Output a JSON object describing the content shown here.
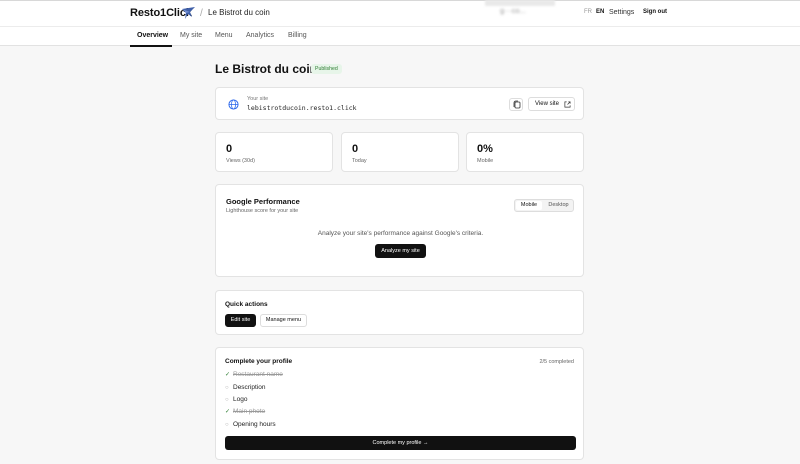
{
  "header": {
    "brand": "Resto1Click",
    "breadcrumb_sep": "/",
    "site_name": "Le Bistrot du coin",
    "account_blurred": "g···co...",
    "lang_fr": "FR",
    "lang_en": "EN",
    "settings": "Settings",
    "sign_out": "Sign out"
  },
  "tabs": [
    {
      "label": "Overview"
    },
    {
      "label": "My site"
    },
    {
      "label": "Menu"
    },
    {
      "label": "Analytics"
    },
    {
      "label": "Billing"
    }
  ],
  "page": {
    "title": "Le Bistrot du coin",
    "status": "Published"
  },
  "site_card": {
    "label": "Your site",
    "url": "lebistrotducoin.resto1.click",
    "view_label": "View site"
  },
  "stats": [
    {
      "value": "0",
      "label": "Views (30d)"
    },
    {
      "value": "0",
      "label": "Today"
    },
    {
      "value": "0%",
      "label": "Mobile"
    }
  ],
  "performance": {
    "title": "Google Performance",
    "subtitle": "Lighthouse score for your site",
    "mobile": "Mobile",
    "desktop": "Desktop",
    "message": "Analyze your site's performance against Google's criteria.",
    "analyze": "Analyze my site"
  },
  "quick_actions": {
    "title": "Quick actions",
    "edit": "Edit site",
    "manage_menu": "Manage menu"
  },
  "profile": {
    "title": "Complete your profile",
    "progress": "2/5 completed",
    "items": [
      {
        "label": "Restaurant name",
        "mark": "✓"
      },
      {
        "label": "Description",
        "mark": "○"
      },
      {
        "label": "Logo",
        "mark": "○"
      },
      {
        "label": "Main photo",
        "mark": "✓"
      },
      {
        "label": "Opening hours",
        "mark": "○"
      }
    ],
    "cta": "Complete my profile →"
  },
  "colors": {
    "accent": "#111111",
    "success_bg": "#e7f5e9",
    "success_text": "#2e7d32"
  }
}
